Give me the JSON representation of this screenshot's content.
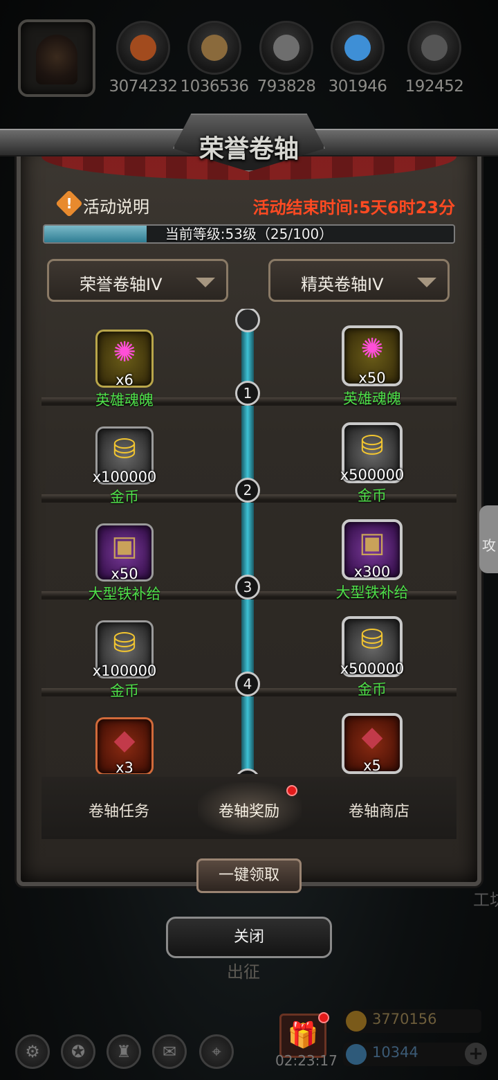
{
  "resources": [
    {
      "icon": "meat-icon",
      "value": "3074232",
      "color": "#a24b1e"
    },
    {
      "icon": "wood-icon",
      "value": "1036536",
      "color": "#8a6a3c"
    },
    {
      "icon": "stone-icon",
      "value": "793828",
      "color": "#6e6e6e"
    },
    {
      "icon": "crystal-icon",
      "value": "301946",
      "color": "#3e8fd6"
    },
    {
      "icon": "iron-icon",
      "value": "192452",
      "color": "#555555"
    }
  ],
  "dialog": {
    "title": "荣誉卷轴",
    "info_label": "活动说明",
    "end_time": "活动结束时间:5天6时23分",
    "level_text": "当前等级:53级（25/100）",
    "progress": 0.25,
    "left_dropdown": "荣誉卷轴IV",
    "right_dropdown": "精英卷轴IV"
  },
  "rows": [
    {
      "level": "1",
      "honor": {
        "icon": "soul-orb-icon",
        "frame": "gold",
        "glyph": "✺",
        "count": "x6",
        "name": "英雄魂魄"
      },
      "elite": {
        "icon": "soul-orb-icon",
        "frame": "gold",
        "glyph": "✺",
        "count": "x50",
        "name": "英雄魂魄"
      }
    },
    {
      "level": "2",
      "honor": {
        "icon": "gold-coins-icon",
        "frame": "gray",
        "glyph": "⛁",
        "count": "x100000",
        "name": "金币"
      },
      "elite": {
        "icon": "gold-coins-icon",
        "frame": "gray",
        "glyph": "⛁",
        "count": "x500000",
        "name": "金币"
      }
    },
    {
      "level": "3",
      "honor": {
        "icon": "treasure-chest-icon",
        "frame": "purple",
        "glyph": "▣",
        "count": "x50",
        "name": "大型铁补给"
      },
      "elite": {
        "icon": "treasure-chest-icon",
        "frame": "purple",
        "glyph": "▣",
        "count": "x300",
        "name": "大型铁补给"
      }
    },
    {
      "level": "4",
      "honor": {
        "icon": "gold-coins-icon",
        "frame": "gray",
        "glyph": "⛁",
        "count": "x100000",
        "name": "金币"
      },
      "elite": {
        "icon": "gold-coins-icon",
        "frame": "gray",
        "glyph": "⛁",
        "count": "x500000",
        "name": "金币"
      }
    },
    {
      "level": "5",
      "honor": {
        "icon": "red-ore-icon",
        "frame": "red",
        "glyph": "◆",
        "count": "x3",
        "name": ""
      },
      "elite": {
        "icon": "red-ore-icon",
        "frame": "red",
        "glyph": "◆",
        "count": "x5",
        "name": ""
      }
    }
  ],
  "tabs": [
    "卷轴任务",
    "卷轴奖励",
    "卷轴商店"
  ],
  "active_tab": "卷轴奖励",
  "claim_all": "一键领取",
  "close": "关闭",
  "behind": {
    "march": "出征",
    "side_tab": "攻城",
    "side_label": "工坊"
  },
  "bottom_bar": {
    "timer": "02:23:17",
    "gold": "3770156",
    "gems": "10344"
  }
}
